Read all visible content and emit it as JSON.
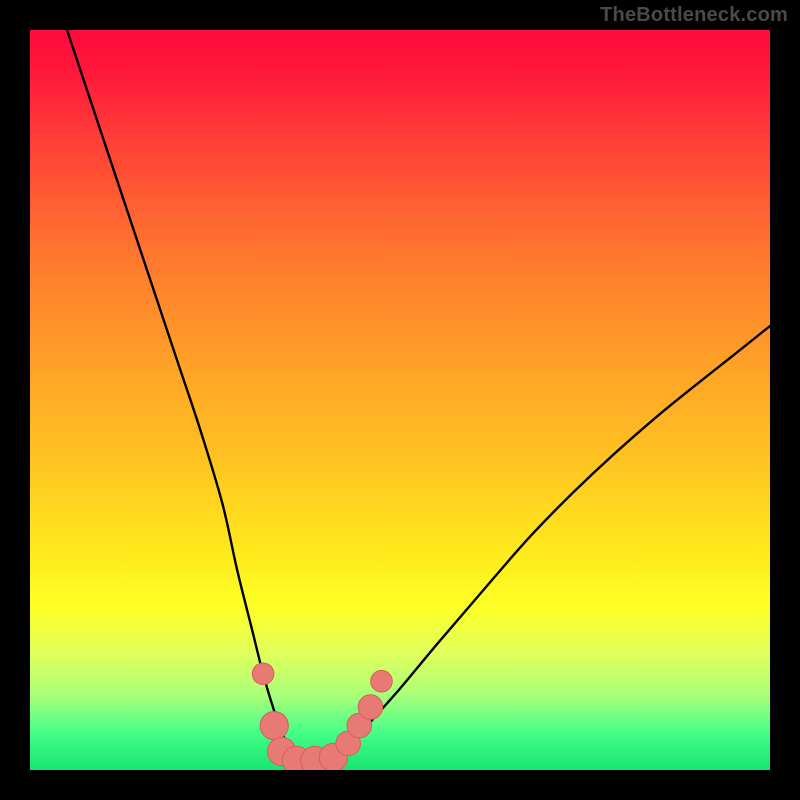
{
  "watermark": "TheBottleneck.com",
  "colors": {
    "frame": "#000000",
    "curve": "#000000",
    "marker_fill": "#E77A74",
    "marker_stroke": "#D85E58",
    "gradient_top": "#ff0a3c",
    "gradient_bottom": "#18e46f"
  },
  "chart_data": {
    "type": "line",
    "title": "",
    "xlabel": "",
    "ylabel": "",
    "xlim": [
      0,
      100
    ],
    "ylim": [
      0,
      100
    ],
    "grid": false,
    "legend": false,
    "series": [
      {
        "name": "bottleneck-curve",
        "x": [
          5,
          8,
          11,
          14,
          17,
          20,
          23,
          26,
          28,
          30,
          31.5,
          33,
          34.5,
          36,
          38,
          40,
          43,
          46,
          50,
          55,
          61,
          68,
          76,
          85,
          95,
          100
        ],
        "y": [
          100,
          91,
          82,
          73,
          64,
          55,
          46,
          36,
          27,
          19,
          13,
          8,
          4,
          2,
          1,
          1,
          3,
          6.5,
          11,
          17,
          24,
          32,
          40,
          48,
          56,
          60
        ]
      }
    ],
    "markers": [
      {
        "x": 31.5,
        "y": 13,
        "r": 1.3
      },
      {
        "x": 33.0,
        "y": 6,
        "r": 2.2
      },
      {
        "x": 34.0,
        "y": 2.5,
        "r": 2.2
      },
      {
        "x": 36.0,
        "y": 1.3,
        "r": 2.2
      },
      {
        "x": 38.5,
        "y": 1.3,
        "r": 2.2
      },
      {
        "x": 41.0,
        "y": 1.7,
        "r": 2.2
      },
      {
        "x": 43.0,
        "y": 3.6,
        "r": 1.7
      },
      {
        "x": 44.5,
        "y": 6.0,
        "r": 1.7
      },
      {
        "x": 46.0,
        "y": 8.5,
        "r": 1.7
      },
      {
        "x": 47.5,
        "y": 12.0,
        "r": 1.3
      }
    ]
  }
}
